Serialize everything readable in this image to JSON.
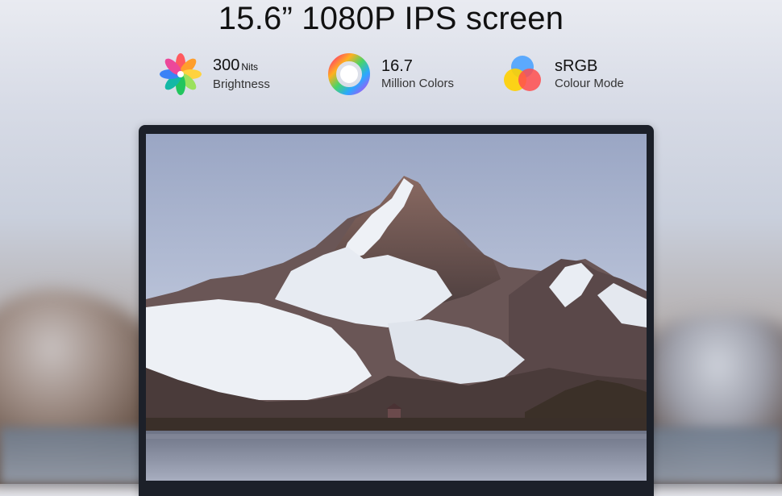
{
  "headline": "15.6” 1080P IPS screen",
  "features": [
    {
      "icon": "brightness-flower-icon",
      "value": "300",
      "unit": "Nits",
      "label": "Brightness"
    },
    {
      "icon": "color-wheel-icon",
      "value": "16.7",
      "unit": "",
      "label": "Million Colors"
    },
    {
      "icon": "srgb-circles-icon",
      "value": "sRGB",
      "unit": "",
      "label": "Colour Mode"
    }
  ]
}
